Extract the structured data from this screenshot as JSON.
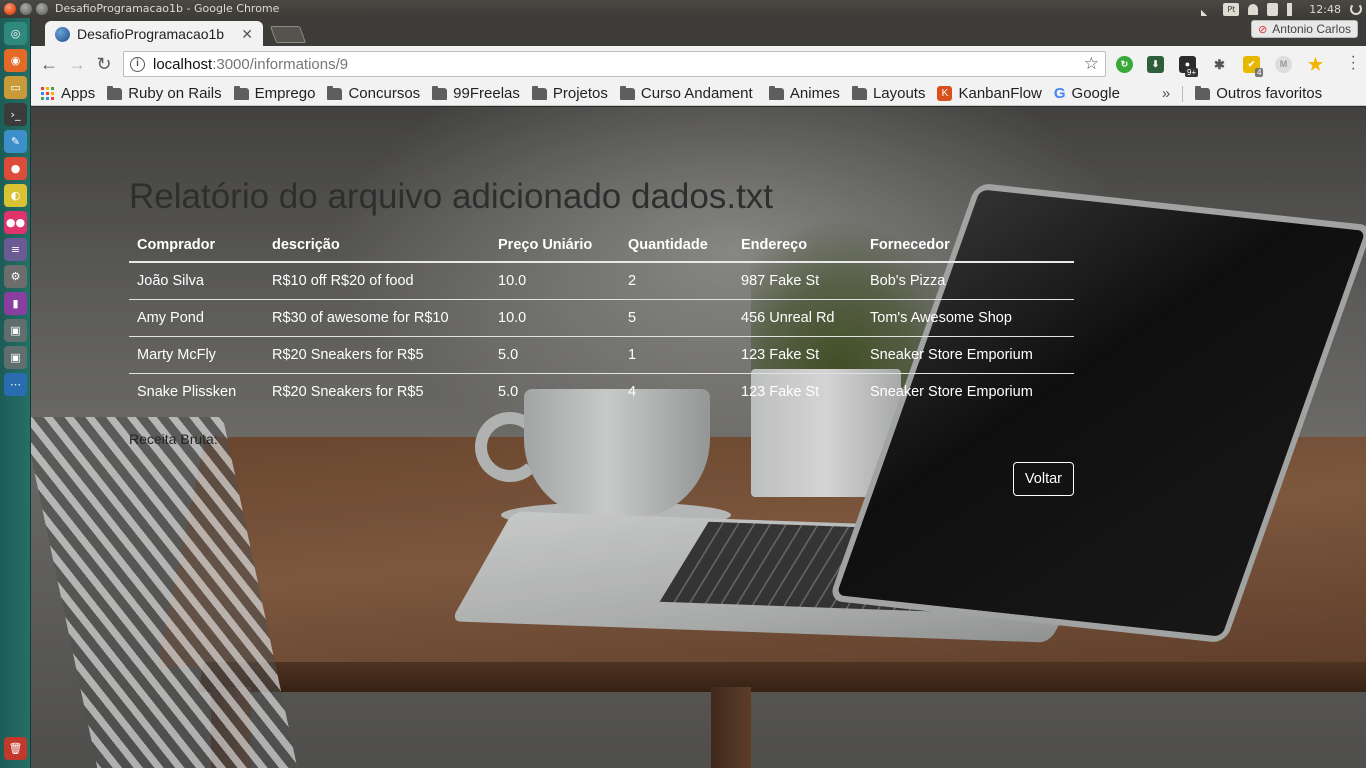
{
  "os": {
    "window_title": "DesafioProgramacao1b - Google Chrome",
    "keyboard_layout": "Pt",
    "clock": "12:48"
  },
  "browser": {
    "tab_title": "DesafioProgramacao1b",
    "profile_name": "Antonio Carlos",
    "url_host": "localhost",
    "url_path": ":3000/informations/9",
    "extension_badges": {
      "badge_1": "9+",
      "badge_2": "4"
    },
    "bookmarks": [
      {
        "label": "Apps",
        "icon": "apps-grid-icon"
      },
      {
        "label": "Ruby on Rails",
        "icon": "folder-icon"
      },
      {
        "label": "Emprego",
        "icon": "folder-icon"
      },
      {
        "label": "Concursos",
        "icon": "folder-icon"
      },
      {
        "label": "99Freelas",
        "icon": "folder-icon"
      },
      {
        "label": "Projetos",
        "icon": "folder-icon"
      },
      {
        "label": "Curso Andament",
        "icon": "folder-icon"
      },
      {
        "label": "Animes",
        "icon": "folder-icon"
      },
      {
        "label": "Layouts",
        "icon": "folder-icon"
      },
      {
        "label": "KanbanFlow",
        "icon": "kanbanflow-icon"
      },
      {
        "label": "Google",
        "icon": "google-icon"
      }
    ],
    "bookmarks_overflow": "»",
    "other_bookmarks": "Outros favoritos"
  },
  "page": {
    "title": "Relatório do arquivo adicionado dados.txt",
    "table": {
      "headers": [
        "Comprador",
        "descrição",
        "Preço Uniário",
        "Quantidade",
        "Endereço",
        "Fornecedor"
      ],
      "rows": [
        [
          "João Silva",
          "R$10 off R$20 of food",
          "10.0",
          "2",
          "987 Fake St",
          "Bob's Pizza"
        ],
        [
          "Amy Pond",
          "R$30 of awesome for R$10",
          "10.0",
          "5",
          "456 Unreal Rd",
          "Tom's Awesome Shop"
        ],
        [
          "Marty McFly",
          "R$20 Sneakers for R$5",
          "5.0",
          "1",
          "123 Fake St",
          "Sneaker Store Emporium"
        ],
        [
          "Snake Plissken",
          "R$20 Sneakers for R$5",
          "5.0",
          "4",
          "123 Fake St",
          "Sneaker Store Emporium"
        ]
      ]
    },
    "revenue_label": "Receita Bruta:",
    "back_button": "Voltar"
  }
}
